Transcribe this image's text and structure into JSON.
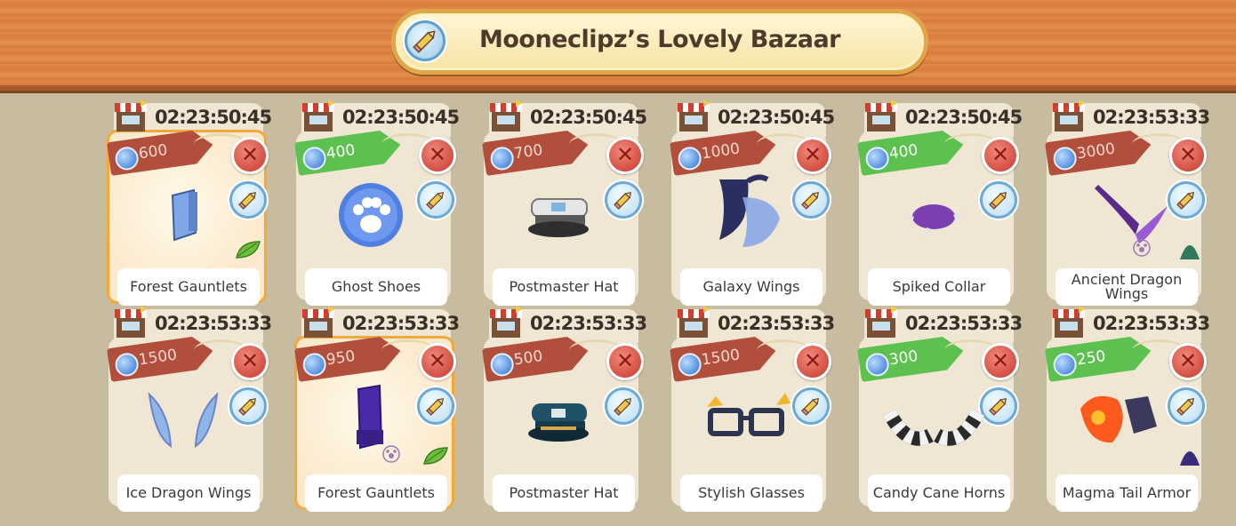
{
  "shop": {
    "title": "Mooneclipz’s Lovely Bazaar",
    "edit_icon": "pencil-icon"
  },
  "items": [
    {
      "timer": "02:23:50:45",
      "price": "600",
      "tag": "red",
      "name": "Forest Gauntlets",
      "selected": true,
      "leaf": true,
      "art": "gauntlet-blue"
    },
    {
      "timer": "02:23:50:45",
      "price": "400",
      "tag": "green",
      "name": "Ghost Shoes",
      "art": "paw-orb"
    },
    {
      "timer": "02:23:50:45",
      "price": "700",
      "tag": "red",
      "name": "Postmaster Hat",
      "art": "hat-white"
    },
    {
      "timer": "02:23:50:45",
      "price": "1000",
      "tag": "red",
      "name": "Galaxy Wings",
      "art": "wings-galaxy"
    },
    {
      "timer": "02:23:50:45",
      "price": "400",
      "tag": "green",
      "name": "Spiked Collar",
      "art": "collar-purple"
    },
    {
      "timer": "02:23:53:33",
      "price": "3000",
      "tag": "red",
      "name": "Ancient Dragon Wings",
      "pet_icon": true,
      "creature": "green",
      "art": "wings-purple"
    },
    {
      "timer": "02:23:53:33",
      "price": "1500",
      "tag": "red",
      "name": "Ice Dragon Wings",
      "art": "wings-ice"
    },
    {
      "timer": "02:23:53:33",
      "price": "950",
      "tag": "red",
      "name": "Forest Gauntlets",
      "selected": true,
      "leaf": true,
      "pet_icon": true,
      "art": "gauntlet-purple"
    },
    {
      "timer": "02:23:53:33",
      "price": "500",
      "tag": "red",
      "name": "Postmaster Hat",
      "art": "hat-teal"
    },
    {
      "timer": "02:23:53:33",
      "price": "1500",
      "tag": "red",
      "name": "Stylish Glasses",
      "art": "glasses"
    },
    {
      "timer": "02:23:53:33",
      "price": "300",
      "tag": "green",
      "name": "Candy Cane Horns",
      "art": "horns"
    },
    {
      "timer": "02:23:53:33",
      "price": "250",
      "tag": "green",
      "name": "Magma Tail Armor",
      "creature": "purple",
      "art": "magma"
    }
  ]
}
